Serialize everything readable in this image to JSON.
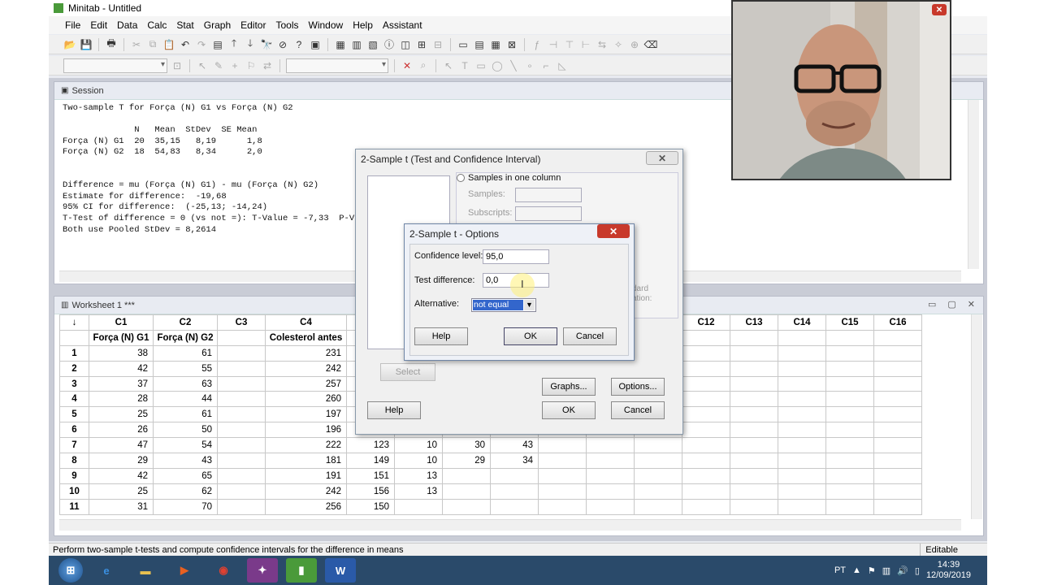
{
  "app": {
    "title": "Minitab - Untitled"
  },
  "menu": [
    "File",
    "Edit",
    "Data",
    "Calc",
    "Stat",
    "Graph",
    "Editor",
    "Tools",
    "Window",
    "Help",
    "Assistant"
  ],
  "session": {
    "title": "Session",
    "lines": [
      "Two-sample T for Força (N) G1 vs Força (N) G2",
      "",
      "              N   Mean  StDev  SE Mean",
      "Força (N) G1  20  35,15   8,19      1,8",
      "Força (N) G2  18  54,83   8,34      2,0",
      "",
      "",
      "Difference = mu (Força (N) G1) - mu (Força (N) G2)",
      "Estimate for difference:  -19,68",
      "95% CI for difference:  (-25,13; -14,24)",
      "T-Test of difference = 0 (vs not =): T-Value = -7,33  P-V",
      "Both use Pooled StDev = 8,2614"
    ]
  },
  "worksheet": {
    "title": "Worksheet 1 ***",
    "corner": "↓",
    "columns": [
      "C1",
      "C2",
      "C3",
      "C4",
      "",
      "",
      "",
      "",
      "",
      "",
      "C11",
      "C12",
      "C13",
      "C14",
      "C15",
      "C16"
    ],
    "names": [
      "Força (N) G1",
      "Força (N) G2",
      "",
      "Colesterol antes",
      "C",
      "",
      "",
      "",
      "",
      "",
      "",
      "",
      "",
      "",
      "",
      ""
    ],
    "rows": [
      [
        "1",
        "38",
        "61",
        "",
        "231",
        "",
        "",
        "",
        "",
        "",
        "",
        "",
        "",
        "",
        "",
        "",
        ""
      ],
      [
        "2",
        "42",
        "55",
        "",
        "242",
        "",
        "",
        "",
        "",
        "",
        "",
        "",
        "",
        "",
        "",
        "",
        ""
      ],
      [
        "3",
        "37",
        "63",
        "",
        "257",
        "",
        "",
        "",
        "",
        "",
        "",
        "",
        "",
        "",
        "",
        "",
        ""
      ],
      [
        "4",
        "28",
        "44",
        "",
        "260",
        "",
        "",
        "",
        "",
        "",
        "",
        "",
        "",
        "",
        "",
        "",
        ""
      ],
      [
        "5",
        "25",
        "61",
        "",
        "197",
        "",
        "",
        "",
        "",
        "",
        "",
        "",
        "",
        "",
        "",
        "",
        ""
      ],
      [
        "6",
        "26",
        "50",
        "",
        "196",
        "",
        "",
        "",
        "",
        "",
        "",
        "",
        "",
        "",
        "",
        "",
        ""
      ],
      [
        "7",
        "47",
        "54",
        "",
        "222",
        "123",
        "10",
        "30",
        "43",
        "",
        "",
        "",
        "",
        "",
        "",
        "",
        ""
      ],
      [
        "8",
        "29",
        "43",
        "",
        "181",
        "149",
        "10",
        "29",
        "34",
        "",
        "",
        "",
        "",
        "",
        "",
        "",
        ""
      ],
      [
        "9",
        "42",
        "65",
        "",
        "191",
        "151",
        "13",
        "",
        "",
        "",
        "",
        "",
        "",
        "",
        "",
        "",
        ""
      ],
      [
        "10",
        "25",
        "62",
        "",
        "242",
        "156",
        "13",
        "",
        "",
        "",
        "",
        "",
        "",
        "",
        "",
        "",
        ""
      ],
      [
        "11",
        "31",
        "70",
        "",
        "256",
        "150",
        "",
        "",
        "",
        "",
        "",
        "",
        "",
        "",
        "",
        "",
        ""
      ]
    ]
  },
  "dialog_main": {
    "title": "2-Sample t (Test and Confidence Interval)",
    "radio_label": "Samples in one column",
    "samples_label": "Samples:",
    "subscripts_label": "Subscripts:",
    "select_button": "Select",
    "help_button": "Help",
    "graphs_button": "Graphs...",
    "options_button": "Options...",
    "ok_button": "OK",
    "cancel_button": "Cancel",
    "partial_text_1": "dard",
    "partial_text_2": "ation:"
  },
  "dialog_options": {
    "title": "2-Sample t - Options",
    "confidence_label": "Confidence level:",
    "confidence_value": "95,0",
    "test_diff_label": "Test difference:",
    "test_diff_value": "0,0",
    "alternative_label": "Alternative:",
    "alternative_value": "not equal",
    "help_button": "Help",
    "ok_button": "OK",
    "cancel_button": "Cancel"
  },
  "statusbar": {
    "message": "Perform two-sample t-tests and compute confidence intervals for the difference in means",
    "mode": "Editable"
  },
  "taskbar": {
    "lang": "PT",
    "time": "14:39",
    "date": "12/09/2019"
  },
  "colors": {
    "selection": "#3366cc",
    "close_red": "#c8392b",
    "taskbar": "#2a4a6a"
  }
}
